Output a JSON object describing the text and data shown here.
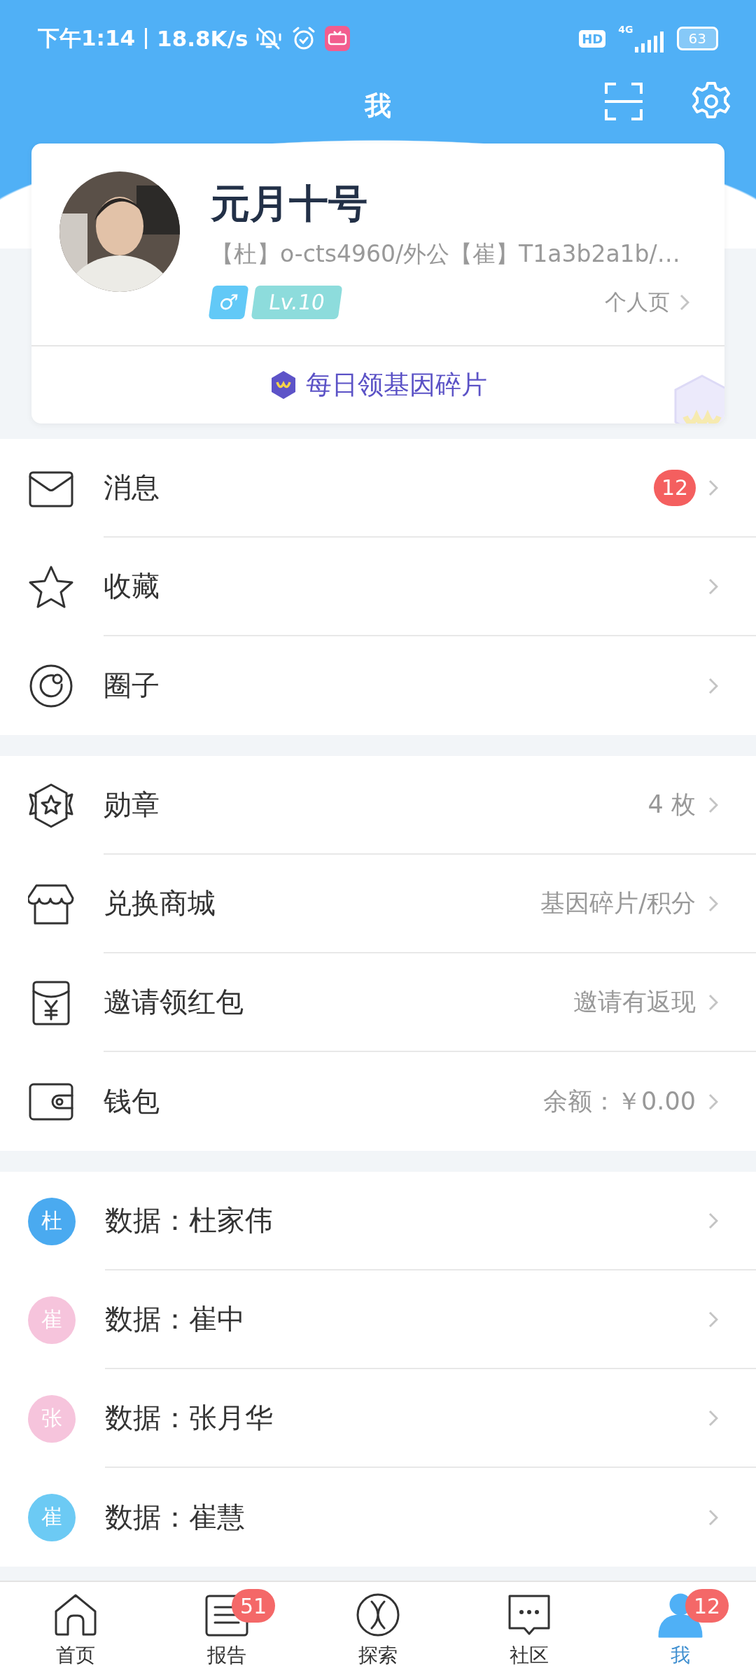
{
  "status_bar": {
    "time": "下午1:14",
    "speed": "18.8K/s",
    "hd": "HD",
    "network": "4G",
    "battery": "63"
  },
  "header": {
    "title": "我"
  },
  "profile": {
    "name": "元月十号",
    "subtitle": "【杜】o-cts4960/外公【崔】T1a3b2a1b/…",
    "gender": "♂",
    "level": "Lv.10",
    "link": "个人页",
    "daily": "每日领基因碎片"
  },
  "menu_groups": [
    [
      {
        "kind": "mail",
        "label": "消息",
        "badge": "12"
      },
      {
        "kind": "star",
        "label": "收藏"
      },
      {
        "kind": "circle",
        "label": "圈子"
      }
    ],
    [
      {
        "kind": "medal",
        "label": "勋章",
        "value": "4 枚"
      },
      {
        "kind": "shop",
        "label": "兑换商城",
        "value": "基因碎片/积分"
      },
      {
        "kind": "envelope",
        "label": "邀请领红包",
        "value": "邀请有返现"
      },
      {
        "kind": "wallet",
        "label": "钱包",
        "value": "余额：￥0.00"
      }
    ]
  ],
  "data_rows": [
    {
      "initial": "杜",
      "label": "数据：杜家伟",
      "color": "#4aaaf0"
    },
    {
      "initial": "崔",
      "label": "数据：崔中",
      "color": "#f6c4dc"
    },
    {
      "initial": "张",
      "label": "数据：张月华",
      "color": "#f6c4dc"
    },
    {
      "initial": "崔",
      "label": "数据：崔慧",
      "color": "#6ccaf4"
    }
  ],
  "tabs": [
    {
      "kind": "home",
      "label": "首页",
      "selected": false
    },
    {
      "kind": "report",
      "label": "报告",
      "badge": "51",
      "selected": false
    },
    {
      "kind": "explore",
      "label": "探索",
      "selected": false
    },
    {
      "kind": "chat",
      "label": "社区",
      "selected": false
    },
    {
      "kind": "person",
      "label": "我",
      "badge": "12",
      "selected": true
    }
  ]
}
